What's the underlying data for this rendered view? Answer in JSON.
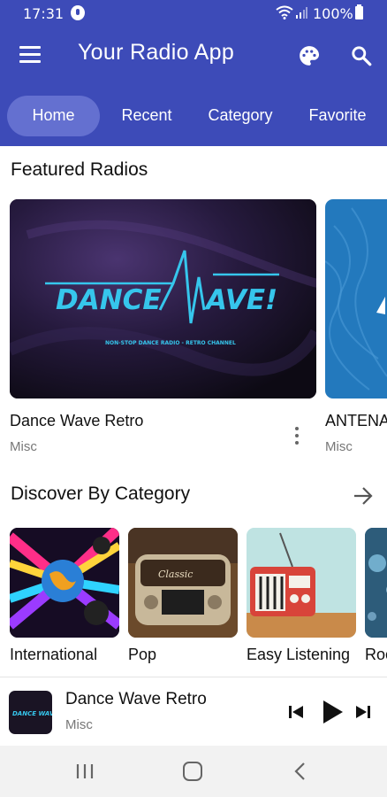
{
  "status_bar": {
    "time": "17:31",
    "battery": "100%",
    "icons": [
      "mic-icon",
      "wifi-icon",
      "signal-icon",
      "battery-icon"
    ]
  },
  "app_bar": {
    "title": "Your Radio App",
    "icons": [
      "menu-icon",
      "palette-icon",
      "search-icon"
    ],
    "background": "#3d4bb8"
  },
  "tabs": [
    {
      "label": "Home",
      "active": true
    },
    {
      "label": "Recent",
      "active": false
    },
    {
      "label": "Category",
      "active": false
    },
    {
      "label": "Favorite",
      "active": false
    }
  ],
  "featured": {
    "title": "Featured Radios",
    "items": [
      {
        "title": "Dance Wave Retro",
        "subtitle": "Misc",
        "logo_text": "DANCE WAVE!",
        "logo_tagline": "NON-STOP DANCE RADIO - RETRO CHANNEL"
      },
      {
        "title": "ANTENA",
        "subtitle": "Misc"
      }
    ]
  },
  "categories": {
    "title": "Discover By Category",
    "items": [
      {
        "label": "International"
      },
      {
        "label": "Pop"
      },
      {
        "label": "Easy Listening"
      },
      {
        "label": "Roc"
      }
    ]
  },
  "player": {
    "title": "Dance Wave Retro",
    "subtitle": "Misc",
    "thumb_text": "DANCE WAVE"
  },
  "colors": {
    "accent": "#3d4bb8",
    "active_tab": "#6470d0",
    "logo_cyan": "#36c6ec"
  }
}
